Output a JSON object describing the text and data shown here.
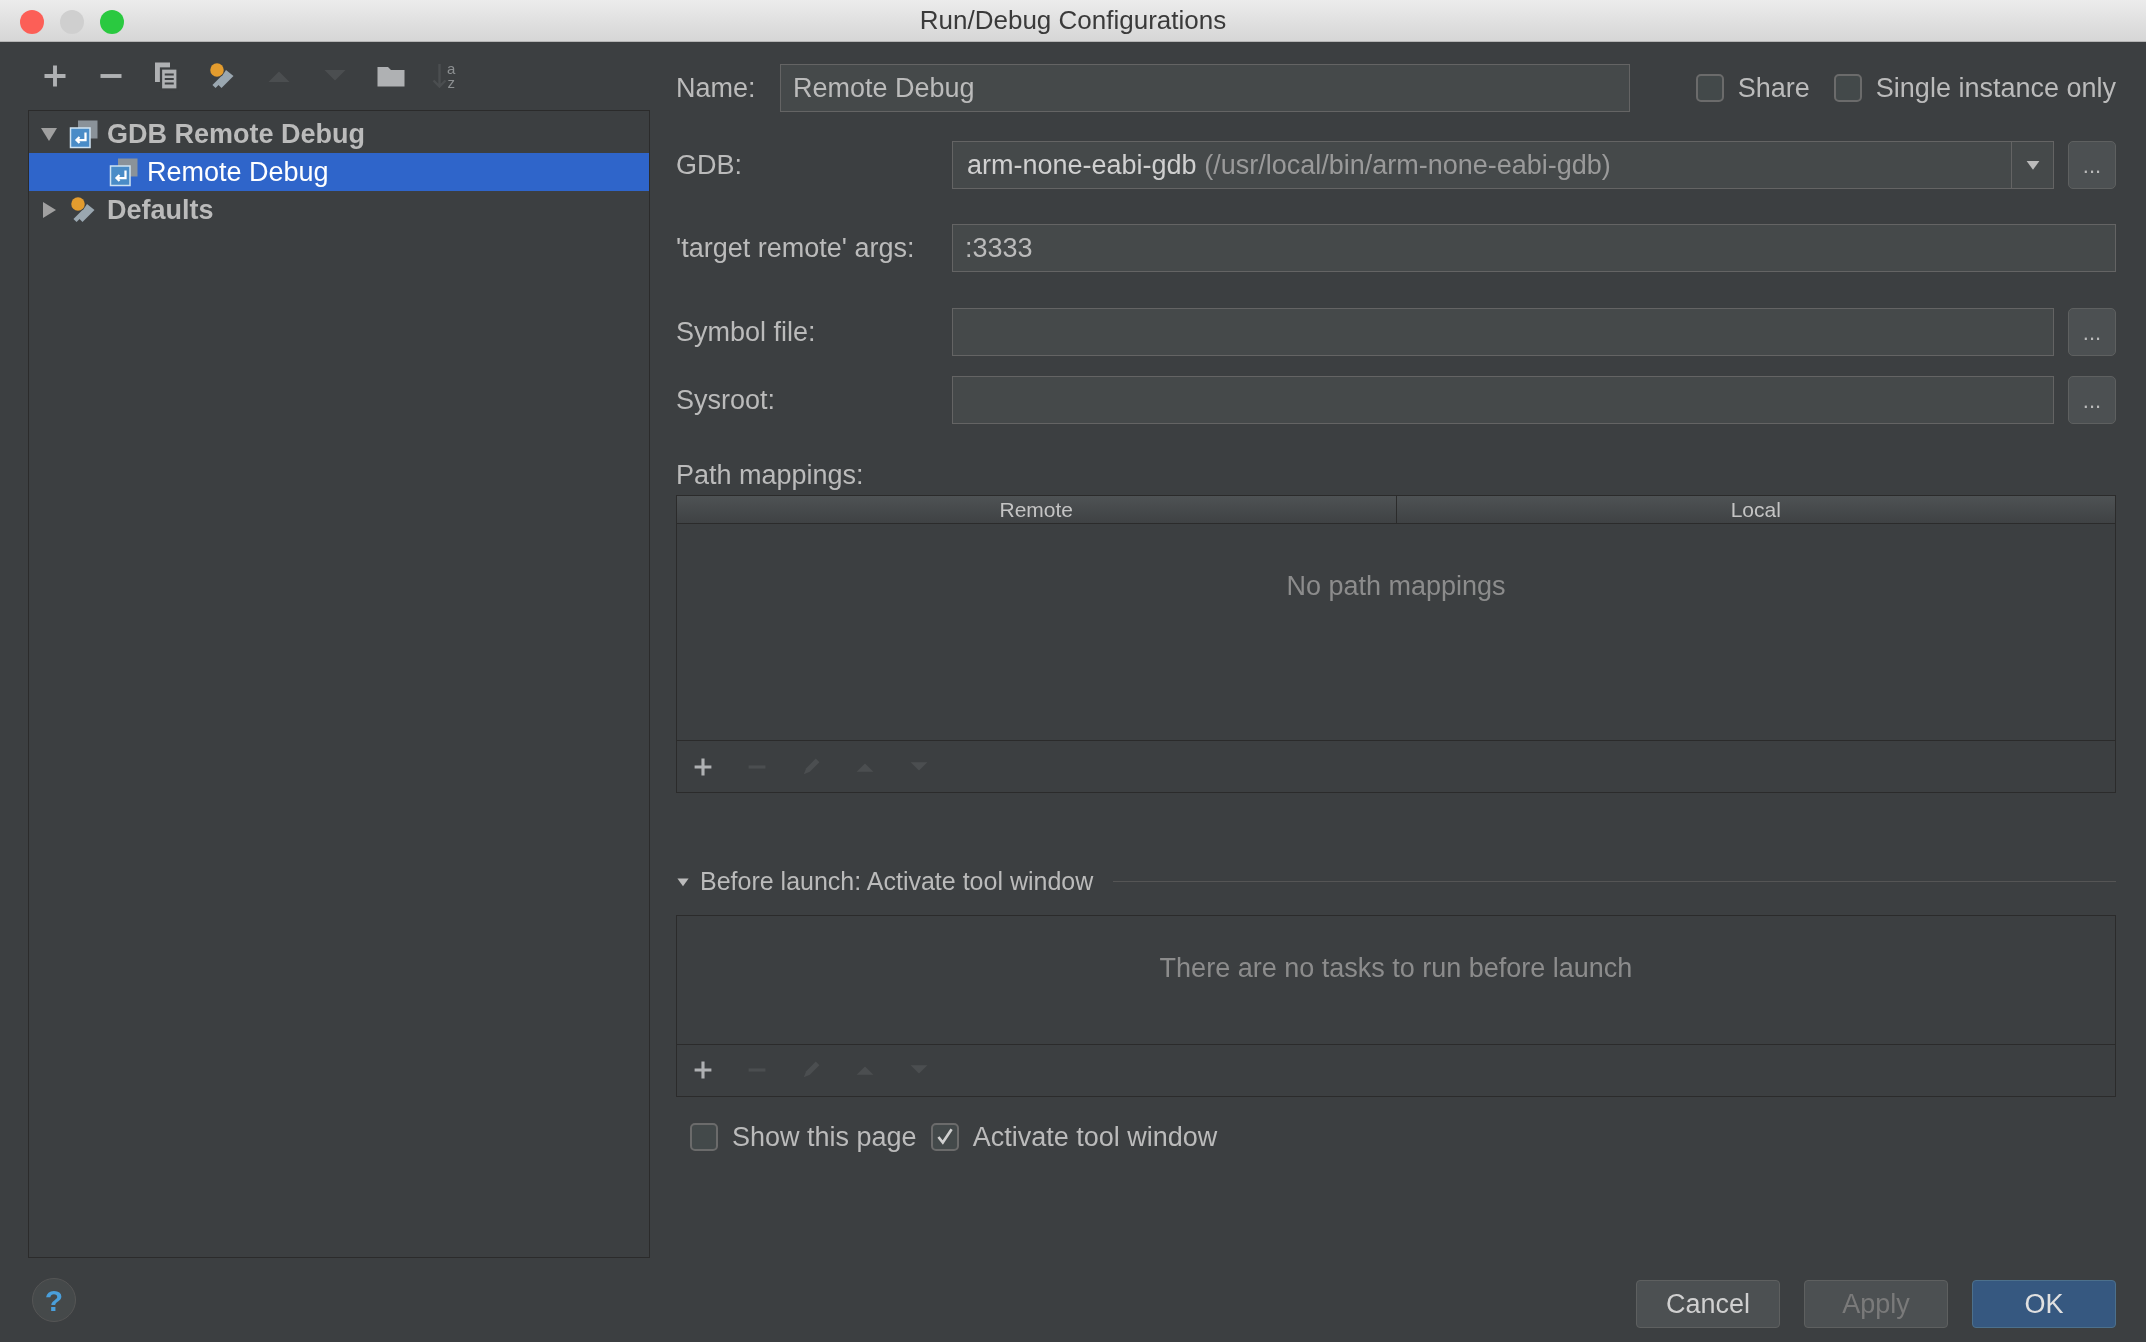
{
  "window": {
    "title": "Run/Debug Configurations"
  },
  "toolbar": [
    {
      "kind": "add",
      "disabled": false
    },
    {
      "kind": "remove",
      "disabled": false
    },
    {
      "kind": "copy",
      "disabled": false
    },
    {
      "kind": "wrench",
      "disabled": false
    },
    {
      "kind": "up",
      "disabled": true
    },
    {
      "kind": "down",
      "disabled": true
    },
    {
      "kind": "folder",
      "disabled": false
    },
    {
      "kind": "sort",
      "disabled": true,
      "letters": [
        "a",
        "z"
      ]
    }
  ],
  "tree": [
    {
      "label": "GDB Remote Debug",
      "kind": "configuration",
      "expanded": true,
      "selected": false,
      "children": [
        {
          "label": "Remote Debug",
          "kind": "configuration",
          "selected": true
        }
      ]
    },
    {
      "label": "Defaults",
      "kind": "defaults",
      "expanded": false,
      "selected": false
    }
  ],
  "name": {
    "label": "Name:",
    "value": "Remote Debug"
  },
  "options": [
    {
      "label": "Share",
      "checked": false
    },
    {
      "label": "Single instance only",
      "checked": false
    }
  ],
  "fields": [
    {
      "kind": "combo",
      "label": "GDB:",
      "value": "arm-none-eabi-gdb",
      "detail": "(/usr/local/bin/arm-none-eabi-gdb)",
      "button": "..."
    },
    {
      "kind": "text",
      "label": "'target remote' args:",
      "value": ":3333"
    },
    {
      "kind": "browse",
      "label": "Symbol file:",
      "button": "..."
    },
    {
      "kind": "browse",
      "label": "Sysroot:",
      "button": "..."
    }
  ],
  "path_mappings": {
    "label": "Path mappings:",
    "columns": [
      "Remote",
      "Local"
    ],
    "empty_text": "No path mappings",
    "toolbar": [
      {
        "kind": "add",
        "disabled": false
      },
      {
        "kind": "remove",
        "disabled": true
      },
      {
        "kind": "edit",
        "disabled": true
      },
      {
        "kind": "up",
        "disabled": true
      },
      {
        "kind": "down",
        "disabled": true
      }
    ]
  },
  "before_launch": {
    "title": "Before launch: Activate tool window",
    "expanded": true,
    "empty_text": "There are no tasks to run before launch",
    "toolbar": [
      {
        "kind": "add",
        "disabled": false
      },
      {
        "kind": "remove",
        "disabled": true
      },
      {
        "kind": "edit",
        "disabled": true
      },
      {
        "kind": "up",
        "disabled": true
      },
      {
        "kind": "down",
        "disabled": true
      }
    ],
    "checkboxes": [
      {
        "label": "Show this page",
        "checked": false
      },
      {
        "label": "Activate tool window",
        "checked": true
      }
    ]
  },
  "help_button": {
    "label": "?"
  },
  "buttons": [
    {
      "label": "Cancel",
      "kind": "normal",
      "disabled": false
    },
    {
      "label": "Apply",
      "kind": "normal",
      "disabled": true
    },
    {
      "label": "OK",
      "kind": "default",
      "disabled": false
    }
  ]
}
